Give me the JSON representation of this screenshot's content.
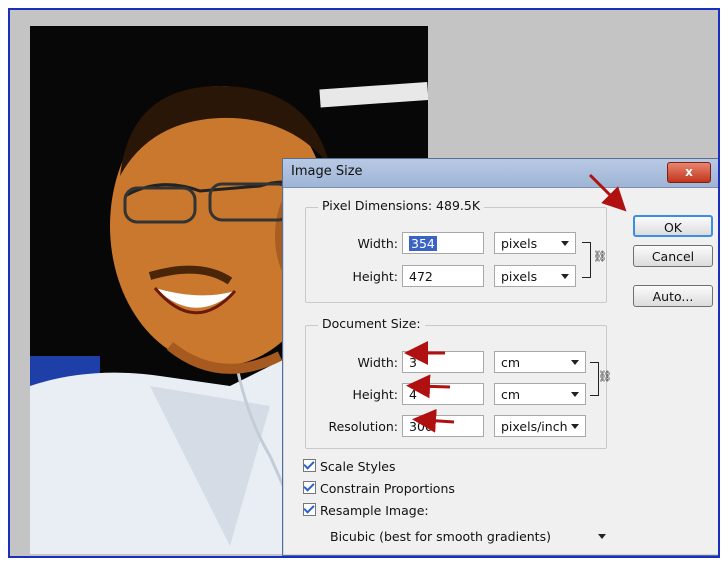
{
  "dialog": {
    "title": "Image Size",
    "close_label": "x",
    "pixel_dimensions": {
      "label": "Pixel Dimensions:",
      "size": "489.5K",
      "width_label": "Width:",
      "width_value": "354",
      "width_unit": "pixels",
      "height_label": "Height:",
      "height_value": "472",
      "height_unit": "pixels"
    },
    "document_size": {
      "label": "Document Size:",
      "width_label": "Width:",
      "width_value": "3",
      "width_unit": "cm",
      "height_label": "Height:",
      "height_value": "4",
      "height_unit": "cm",
      "resolution_label": "Resolution:",
      "resolution_value": "300",
      "resolution_unit": "pixels/inch"
    },
    "options": {
      "scale_styles": "Scale Styles",
      "constrain": "Constrain Proportions",
      "resample": "Resample Image:",
      "resample_method": "Bicubic (best for smooth gradients)"
    },
    "buttons": {
      "ok": "OK",
      "cancel": "Cancel",
      "auto": "Auto..."
    }
  },
  "colors": {
    "annotation_arrow": "#b01010",
    "frame_border": "#1b2fbf",
    "title_bar": "#a9bddc",
    "close_button": "#c8442a"
  }
}
